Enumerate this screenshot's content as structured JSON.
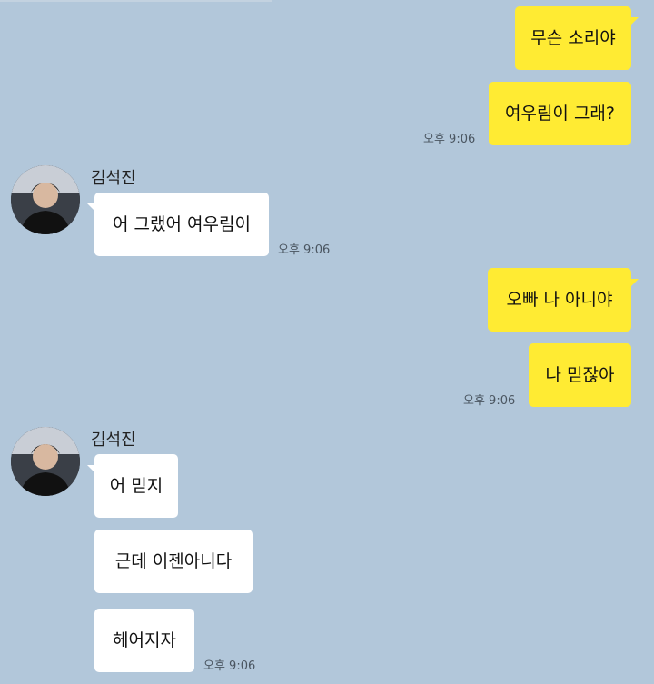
{
  "chat": {
    "contact_name": "김석진",
    "messages": [
      {
        "from": "me",
        "text": "무슨 소리야"
      },
      {
        "from": "me",
        "text": "여우림이 그래?",
        "time": "오후 9:06"
      },
      {
        "from": "friend",
        "text": "어 그랬어 여우림이",
        "time": "오후 9:06"
      },
      {
        "from": "me",
        "text": "오빠 나 아니야"
      },
      {
        "from": "me",
        "text": "나 믿잖아",
        "time": "오후 9:06"
      },
      {
        "from": "friend",
        "text": "어 믿지"
      },
      {
        "from": "friend",
        "text": "근데 이젠아니다"
      },
      {
        "from": "friend",
        "text": "헤어지자",
        "time": "오후 9:06"
      }
    ]
  },
  "colors": {
    "background": "#b2c7da",
    "my_bubble": "#ffeb33",
    "friend_bubble": "#ffffff"
  }
}
